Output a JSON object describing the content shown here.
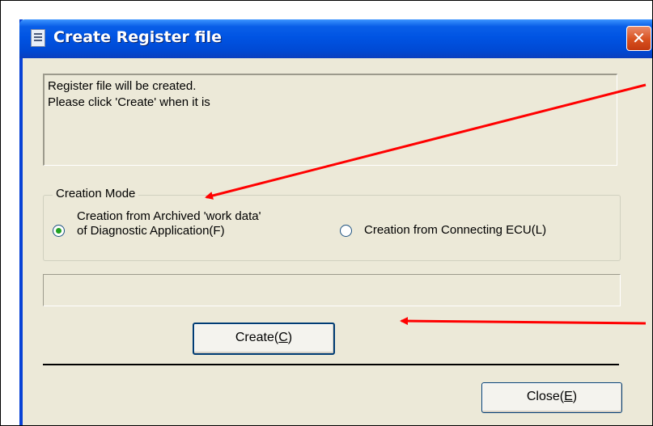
{
  "dialog": {
    "title": "Create Register file",
    "close_glyph": "✕",
    "message_lines": [
      "Register file will be created.",
      "Please click 'Create'  when it is"
    ],
    "creation_mode": {
      "legend": "Creation Mode",
      "option_archived_line1": "Creation from Archived 'work data'",
      "option_archived_line2": "of Diagnostic Application(F)",
      "option_connecting": "Creation from Connecting ECU(L)",
      "selected": "archived"
    },
    "progress_percent": 0,
    "create_button": {
      "label": "Create(",
      "mnemonic": "C",
      "suffix": ")"
    },
    "close_button": {
      "label": "Close(",
      "mnemonic": "E",
      "suffix": ")"
    }
  },
  "icons": {
    "window_icon": "document-icon",
    "close_icon": "close-icon"
  },
  "colors": {
    "annotation_arrow": "#ff0000",
    "titlebar": "#0054e3",
    "dialog_face": "#ece9d8"
  }
}
